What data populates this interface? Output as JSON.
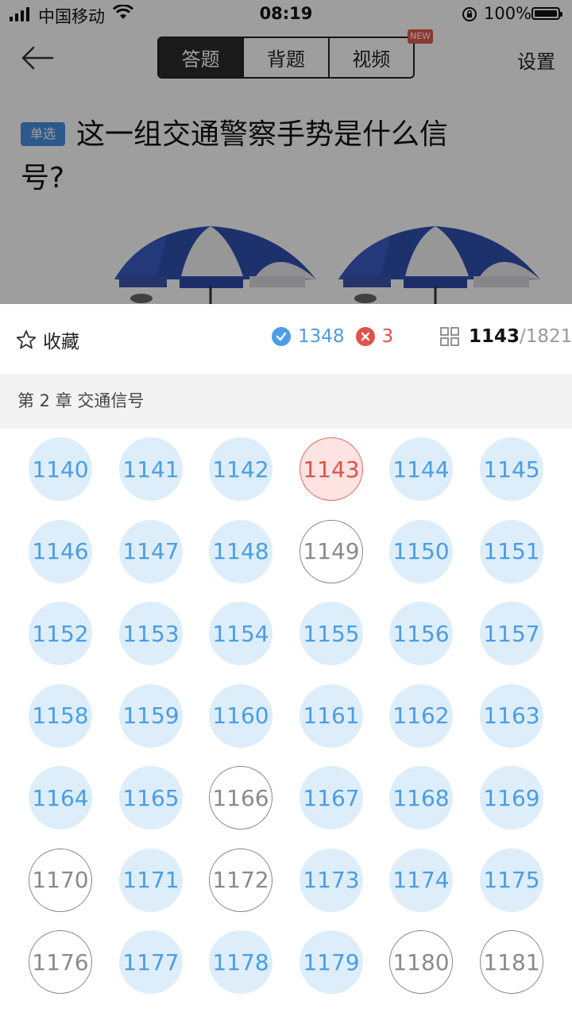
{
  "status_bar": {
    "carrier": "中国移动",
    "time": "08:19",
    "battery": "100%"
  },
  "header": {
    "tabs": [
      "答题",
      "背题",
      "视频"
    ],
    "active_tab": 0,
    "new_badge": "NEW",
    "settings_label": "设置"
  },
  "question": {
    "type_tag": "单选",
    "text": "这一组交通警察手势是什么信号?"
  },
  "sheet": {
    "favorite_label": "收藏",
    "correct_count": "1348",
    "wrong_count": "3",
    "current_index": "1143",
    "total": "/1821",
    "chapter_title": "第 2 章  交通信号",
    "numbers": [
      {
        "n": "1140",
        "s": "done"
      },
      {
        "n": "1141",
        "s": "done"
      },
      {
        "n": "1142",
        "s": "done"
      },
      {
        "n": "1143",
        "s": "current"
      },
      {
        "n": "1144",
        "s": "done"
      },
      {
        "n": "1145",
        "s": "done"
      },
      {
        "n": "1146",
        "s": "done"
      },
      {
        "n": "1147",
        "s": "done"
      },
      {
        "n": "1148",
        "s": "done"
      },
      {
        "n": "1149",
        "s": "empty"
      },
      {
        "n": "1150",
        "s": "done"
      },
      {
        "n": "1151",
        "s": "done"
      },
      {
        "n": "1152",
        "s": "done"
      },
      {
        "n": "1153",
        "s": "done"
      },
      {
        "n": "1154",
        "s": "done"
      },
      {
        "n": "1155",
        "s": "done"
      },
      {
        "n": "1156",
        "s": "done"
      },
      {
        "n": "1157",
        "s": "done"
      },
      {
        "n": "1158",
        "s": "done"
      },
      {
        "n": "1159",
        "s": "done"
      },
      {
        "n": "1160",
        "s": "done"
      },
      {
        "n": "1161",
        "s": "done"
      },
      {
        "n": "1162",
        "s": "done"
      },
      {
        "n": "1163",
        "s": "done"
      },
      {
        "n": "1164",
        "s": "done"
      },
      {
        "n": "1165",
        "s": "done"
      },
      {
        "n": "1166",
        "s": "empty"
      },
      {
        "n": "1167",
        "s": "done"
      },
      {
        "n": "1168",
        "s": "done"
      },
      {
        "n": "1169",
        "s": "done"
      },
      {
        "n": "1170",
        "s": "empty"
      },
      {
        "n": "1171",
        "s": "done"
      },
      {
        "n": "1172",
        "s": "empty"
      },
      {
        "n": "1173",
        "s": "done"
      },
      {
        "n": "1174",
        "s": "done"
      },
      {
        "n": "1175",
        "s": "done"
      },
      {
        "n": "1176",
        "s": "empty"
      },
      {
        "n": "1177",
        "s": "done"
      },
      {
        "n": "1178",
        "s": "done"
      },
      {
        "n": "1179",
        "s": "done"
      },
      {
        "n": "1180",
        "s": "empty"
      },
      {
        "n": "1181",
        "s": "empty"
      }
    ]
  },
  "colors": {
    "accent_blue": "#4a9de6",
    "error_red": "#e0524a",
    "done_fill": "#ddeefa",
    "current_fill": "#fde3e1"
  }
}
